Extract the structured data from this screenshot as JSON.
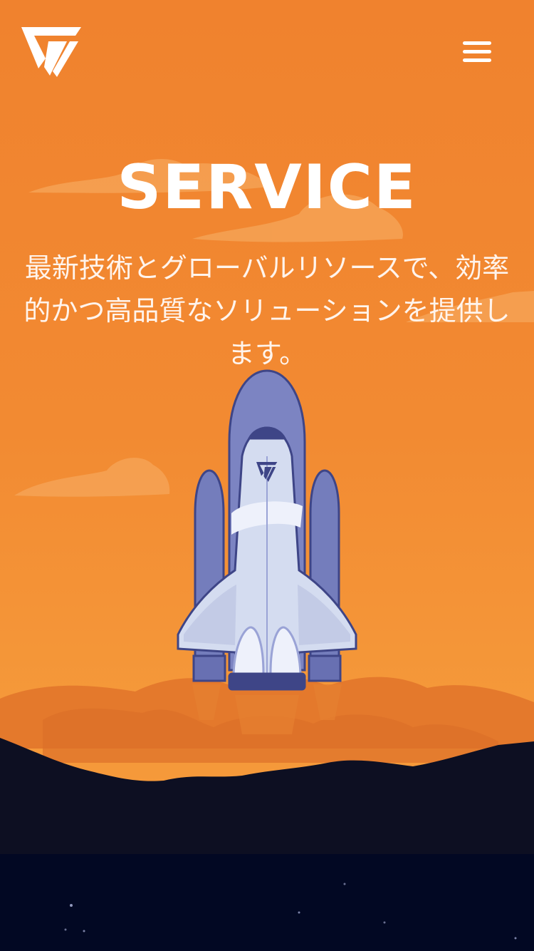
{
  "header": {
    "logo_icon": "brand-triangle-logo-icon",
    "menu_icon": "hamburger-menu-icon"
  },
  "hero": {
    "title": "SERVICE",
    "subtitle": "最新技術とグローバルリソースで、効率的かつ高品質なソリューションを提供します。"
  },
  "illustration": {
    "subject": "space-shuttle-launch",
    "colors": {
      "sky": "#f0822e",
      "cloud": "#f5a65a",
      "smoke": "#e2742a",
      "ground": "#0d0f22",
      "space": "#020823",
      "shuttle_body": "#d4dcf0",
      "shuttle_dark": "#6f78b8",
      "shuttle_outline": "#3e4587"
    }
  }
}
